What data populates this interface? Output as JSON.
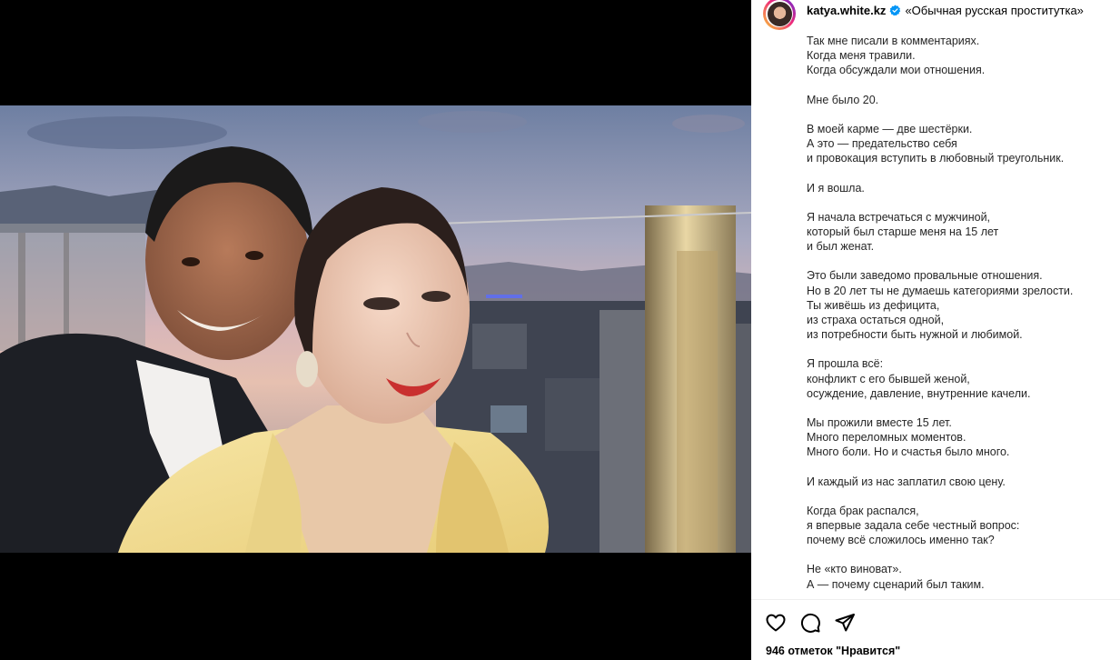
{
  "post": {
    "username": "katya.white.kz",
    "verified_icon": "verified-badge-icon",
    "caption_title": "«Обычная русская проститутка»",
    "caption_paragraphs": [
      [
        "Так мне писали в комментариях.",
        "Когда меня травили.",
        "Когда обсуждали мои отношения."
      ],
      [
        "Мне было 20."
      ],
      [
        "В моей карме — две шестёрки.",
        "А это — предательство себя",
        "и провокация вступить в любовный треугольник."
      ],
      [
        "И я вошла."
      ],
      [
        "Я начала встречаться с мужчиной,",
        "который был старше меня на 15 лет",
        "и был женат."
      ],
      [
        "Это были заведомо провальные отношения.",
        "Но в 20 лет ты не думаешь категориями зрелости.",
        "Ты живёшь из дефицита,",
        "из страха остаться одной,",
        "из потребности быть нужной и любимой."
      ],
      [
        "Я прошла всё:",
        "конфликт с его бывшей женой,",
        "осуждение, давление, внутренние качели."
      ],
      [
        "Мы прожили вместе 15 лет.",
        "Много переломных моментов.",
        "Много боли. Но и счастья было много."
      ],
      [
        "И каждый из нас заплатил свою цену."
      ],
      [
        "Когда брак распался,",
        "я впервые задала себе честный вопрос:",
        "почему всё сложилось именно так?"
      ],
      [
        "Не «кто виноват».",
        "А — почему сценарий был таким."
      ]
    ],
    "likes_text": "946 отметок \"Нравится\""
  },
  "actions": {
    "icons": [
      "heart-icon",
      "comment-icon",
      "share-icon"
    ]
  },
  "colors": {
    "verified_blue": "#0095f6",
    "text": "#262626",
    "jacket_yellow": "#f3dc8e"
  }
}
